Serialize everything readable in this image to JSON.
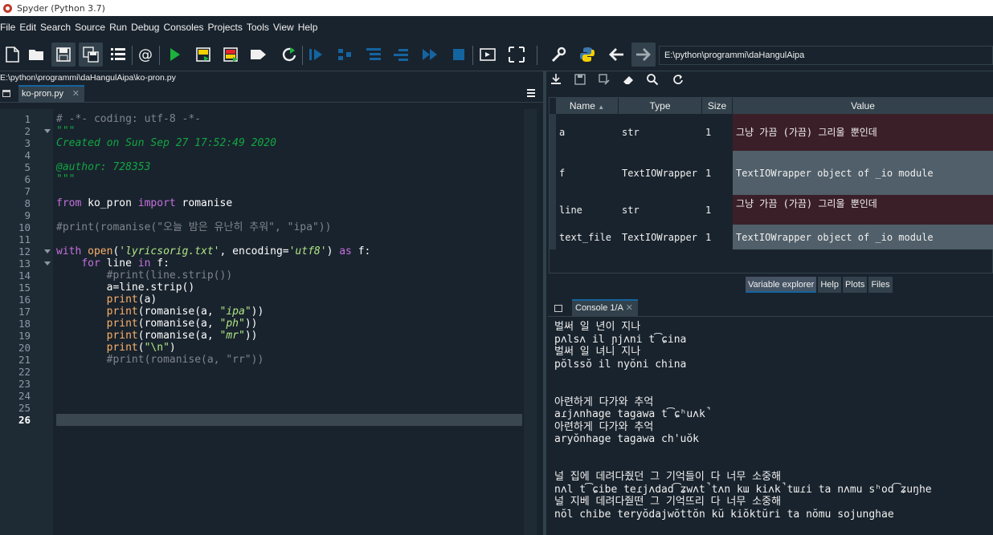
{
  "window": {
    "title": "Spyder (Python 3.7)"
  },
  "menu": [
    "File",
    "Edit",
    "Search",
    "Source",
    "Run",
    "Debug",
    "Consoles",
    "Projects",
    "Tools",
    "View",
    "Help"
  ],
  "toolbar": {
    "working_dir": "E:\\python\\programmi\\daHangulAipa"
  },
  "editor": {
    "path": "E:\\python\\programmi\\daHangulAipa\\ko-pron.py",
    "tab": "ko-pron.py",
    "line_numbers": [
      "1",
      "2",
      "3",
      "4",
      "5",
      "6",
      "7",
      "8",
      "9",
      "10",
      "11",
      "12",
      "13",
      "14",
      "15",
      "16",
      "17",
      "18",
      "19",
      "20",
      "21",
      "22",
      "23",
      "24",
      "25",
      "26"
    ],
    "current_line": "26",
    "lines": [
      [
        [
          "cm",
          "# -*- coding: utf-8 -*-"
        ]
      ],
      [
        [
          "ds",
          "\"\"\""
        ]
      ],
      [
        [
          "ds",
          "Created on Sun Sep 27 17:52:49 2020"
        ]
      ],
      [],
      [
        [
          "ds",
          "@author: 728353"
        ]
      ],
      [
        [
          "ds",
          "\"\"\""
        ]
      ],
      [],
      [
        [
          "kw",
          "from"
        ],
        [
          "pl",
          " ko_pron "
        ],
        [
          "kw",
          "import"
        ],
        [
          "pl",
          " romanise"
        ]
      ],
      [],
      [
        [
          "cm",
          "#print(romanise(\"오늘 밤은 유난히 추워\", \"ipa\"))"
        ]
      ],
      [],
      [
        [
          "kw",
          "with"
        ],
        [
          "pl",
          " "
        ],
        [
          "bi",
          "open"
        ],
        [
          "pl",
          "("
        ],
        [
          "sti",
          "'lyricsorig.txt'"
        ],
        [
          "pl",
          ", encoding="
        ],
        [
          "sti",
          "'utf8'"
        ],
        [
          "pl",
          ") "
        ],
        [
          "kw",
          "as"
        ],
        [
          "pl",
          " f:"
        ]
      ],
      [
        [
          "pl",
          "    "
        ],
        [
          "kw",
          "for"
        ],
        [
          "pl",
          " line "
        ],
        [
          "kw",
          "in"
        ],
        [
          "pl",
          " f:"
        ]
      ],
      [
        [
          "pl",
          "        "
        ],
        [
          "cm",
          "#print(line.strip())"
        ]
      ],
      [
        [
          "pl",
          "        a=line.strip()"
        ]
      ],
      [
        [
          "pl",
          "        "
        ],
        [
          "bi",
          "print"
        ],
        [
          "pl",
          "(a)"
        ]
      ],
      [
        [
          "pl",
          "        "
        ],
        [
          "bi",
          "print"
        ],
        [
          "pl",
          "(romanise(a, "
        ],
        [
          "sti",
          "\"ipa\""
        ],
        [
          "pl",
          "))"
        ]
      ],
      [
        [
          "pl",
          "        "
        ],
        [
          "bi",
          "print"
        ],
        [
          "pl",
          "(romanise(a, "
        ],
        [
          "sti",
          "\"ph\""
        ],
        [
          "pl",
          "))"
        ]
      ],
      [
        [
          "pl",
          "        "
        ],
        [
          "bi",
          "print"
        ],
        [
          "pl",
          "(romanise(a, "
        ],
        [
          "sti",
          "\"mr\""
        ],
        [
          "pl",
          "))"
        ]
      ],
      [
        [
          "pl",
          "        "
        ],
        [
          "bi",
          "print"
        ],
        [
          "pl",
          "("
        ],
        [
          "st",
          "\"\\n\""
        ],
        [
          "pl",
          ")"
        ]
      ],
      [
        [
          "pl",
          "        "
        ],
        [
          "cm",
          "#print(romanise(a, \"rr\"))"
        ]
      ],
      [],
      [],
      [],
      [],
      []
    ],
    "fold_markers": [
      "2",
      "12",
      "13"
    ]
  },
  "variables": {
    "headers": [
      "Name",
      "Type",
      "Size",
      "Value"
    ],
    "rows": [
      {
        "name": "a",
        "type": "str",
        "size": "1",
        "value": "그냥 가끔 (가끔) 그리울 뿐인데",
        "color": "#3b1f28"
      },
      {
        "name": "f",
        "type": "TextIOWrapper",
        "size": "1",
        "value": "TextIOWrapper object of _io module",
        "color": "#505f69"
      },
      {
        "name": "line",
        "type": "str",
        "size": "1",
        "value": "그냥 가끔 (가끔) 그리울 뿐인데",
        "color": "#3b1f28"
      },
      {
        "name": "text_file",
        "type": "TextIOWrapper",
        "size": "1",
        "value": "TextIOWrapper object of _io module",
        "color": "#505f69"
      }
    ]
  },
  "pane_tabs": [
    "Variable explorer",
    "Help",
    "Plots",
    "Files"
  ],
  "console": {
    "tab": "Console 1/A",
    "lines": [
      "벌써 일 년이 지나",
      "pʌlsʌ il ɲjʌni t͡ɕina",
      "벌써 일 녀니 지나",
      "pŏlssŏ il nyŏni china",
      "",
      "",
      "아련하게 다가와 추억",
      "aɾjʌnhage tagawa t͡ɕʰuʌk̚",
      "아련하게 다가와 추억",
      "aryŏnhage tagawa ch'uŏk",
      "",
      "",
      "널 집에 데려다줬던 그 기억들이 다 너무 소중해",
      "nʌl t͡ɕibe teɾjʌdad͡ʑwʌt̚tʌn kɯ kiʌk̚tɯɾi ta nʌmu sʰod͡ʑuŋhe",
      "널 지베 데려다줟떤 그 기억뜨리 다 너무 소중해",
      "nŏl chibe teryŏdajwŏttŏn kŭ kiŏktŭri ta nŏmu sojunghae"
    ]
  }
}
